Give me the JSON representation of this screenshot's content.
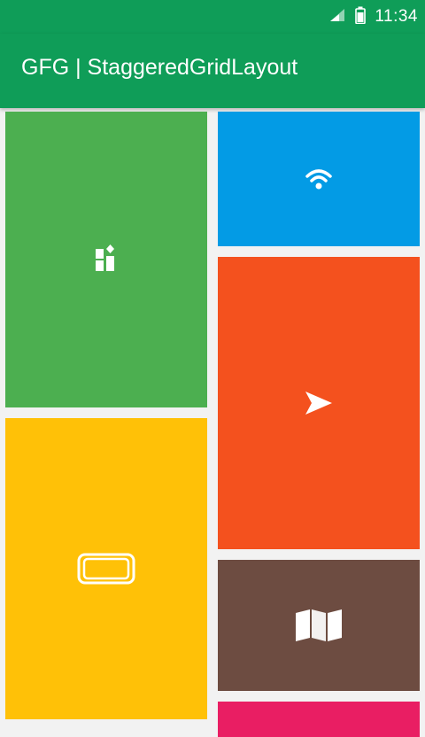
{
  "status_bar": {
    "time": "11:34",
    "icons": [
      "signal-icon",
      "battery-icon"
    ]
  },
  "app_bar": {
    "title": "GFG | StaggeredGridLayout"
  },
  "colors": {
    "primary": "#0f9d58",
    "tiles": [
      "#4caf50",
      "#039be5",
      "#f4511e",
      "#ffc107",
      "#6d4c41",
      "#e91e63"
    ]
  },
  "grid": {
    "tiles": [
      {
        "icon": "dashboard-icon",
        "color": "#4caf50"
      },
      {
        "icon": "wifi-icon",
        "color": "#039be5"
      },
      {
        "icon": "send-icon",
        "color": "#f4511e"
      },
      {
        "icon": "tablet-icon",
        "color": "#ffc107"
      },
      {
        "icon": "map-icon",
        "color": "#6d4c41"
      },
      {
        "icon": "",
        "color": "#e91e63"
      }
    ]
  }
}
